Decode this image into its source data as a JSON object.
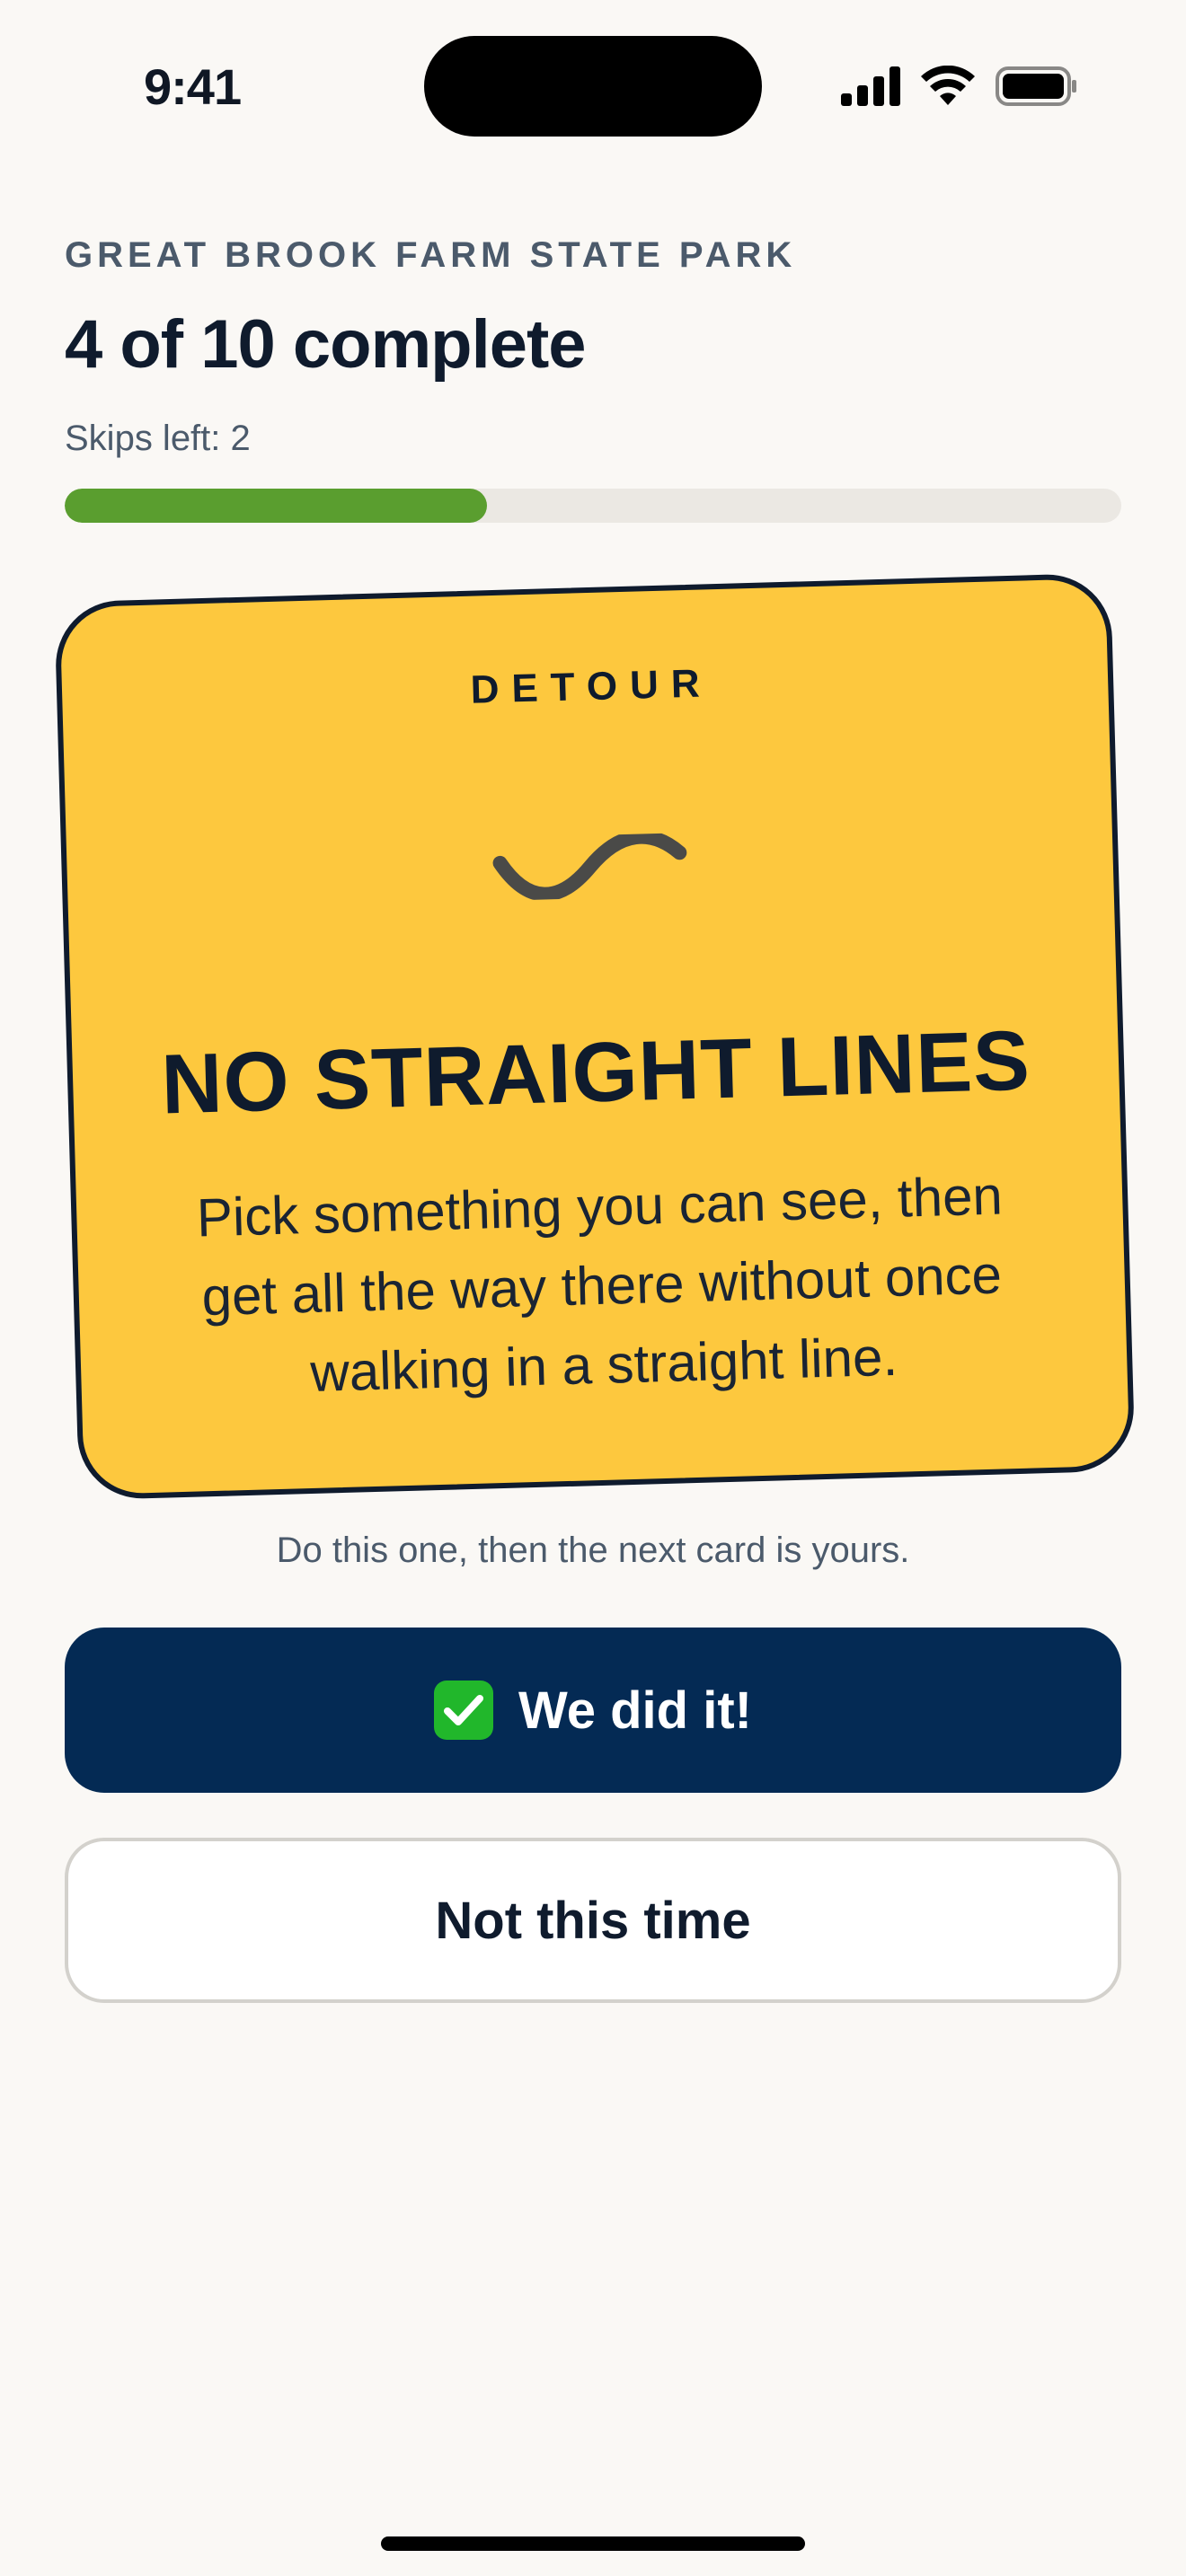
{
  "status_bar": {
    "time": "9:41",
    "icons": [
      "cellular-signal-icon",
      "wifi-icon",
      "battery-icon"
    ]
  },
  "header": {
    "park_name": "GREAT BROOK FARM STATE PARK",
    "progress_title": "4 of 10 complete",
    "skips_label": "Skips left: 2",
    "progress": {
      "completed": 4,
      "total": 10,
      "fill_color": "#5a9e2f"
    }
  },
  "card": {
    "kicker": "DETOUR",
    "icon": "wavy-line-icon",
    "title": "NO STRAIGHT LINES",
    "body": "Pick something you can see, then get all the way there without once walking in a straight line.",
    "background_color": "#fdc83e"
  },
  "hint": "Do this one, then the next card is yours.",
  "actions": {
    "primary_label": "We did it!",
    "primary_icon": "check-mark-button-icon",
    "primary_color": "#042a54",
    "secondary_label": "Not this time"
  }
}
